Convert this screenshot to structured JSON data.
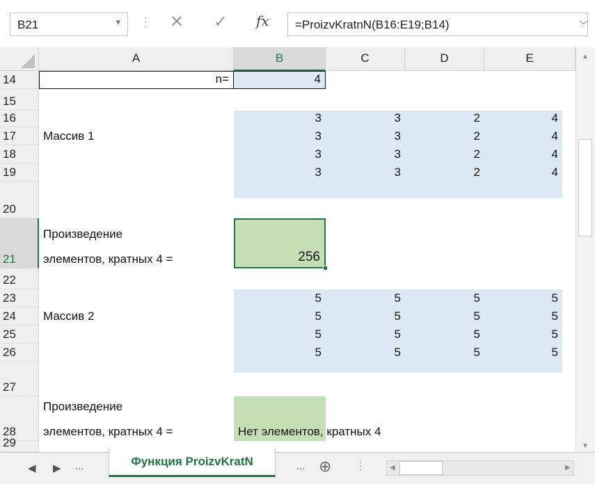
{
  "formula_bar": {
    "name_box": "B21",
    "name_box_arrow": "▾",
    "dots": "⋮",
    "cancel": "✕",
    "enter": "✓",
    "fx": "fx",
    "formula": "=ProizvKratnN(B16:E19;B14)",
    "expand": "﹀"
  },
  "columns": [
    "A",
    "B",
    "C",
    "D",
    "E"
  ],
  "rows": [
    "14",
    "15",
    "16",
    "17",
    "18",
    "19",
    "20",
    "21",
    "22",
    "23",
    "24",
    "25",
    "26",
    "27",
    "28",
    "29"
  ],
  "cells": {
    "a14": "n=",
    "b14": "4",
    "array1": [
      [
        "3",
        "3",
        "2",
        "4"
      ],
      [
        "3",
        "3",
        "2",
        "4"
      ],
      [
        "3",
        "3",
        "2",
        "4"
      ],
      [
        "3",
        "3",
        "2",
        "4"
      ]
    ],
    "a17": "Массив 1",
    "a21_line1": "Произведение",
    "a21_line2": "элементов, кратных 4 =",
    "b21": "256",
    "array2": [
      [
        "5",
        "5",
        "5",
        "5"
      ],
      [
        "5",
        "5",
        "5",
        "5"
      ],
      [
        "5",
        "5",
        "5",
        "5"
      ],
      [
        "5",
        "5",
        "5",
        "5"
      ]
    ],
    "a24": "Массив 2",
    "a28_line1": "Произведение",
    "a28_line2": "элементов, кратных 4 =",
    "b28": "Нет элементов, кратных 4"
  },
  "tabs": {
    "prev": "◀",
    "next": "▶",
    "more_left": "...",
    "active_sheet": "Функция ProizvKratN",
    "more_right": "...",
    "add": "⊕",
    "sep": "⋮"
  },
  "scroll": {
    "up": "▲",
    "down": "▼",
    "left": "◀",
    "right": "▶"
  },
  "colors": {
    "selection_green": "#217346",
    "array_fill": "#dce8f4",
    "result_fill": "#c6dfb4"
  }
}
